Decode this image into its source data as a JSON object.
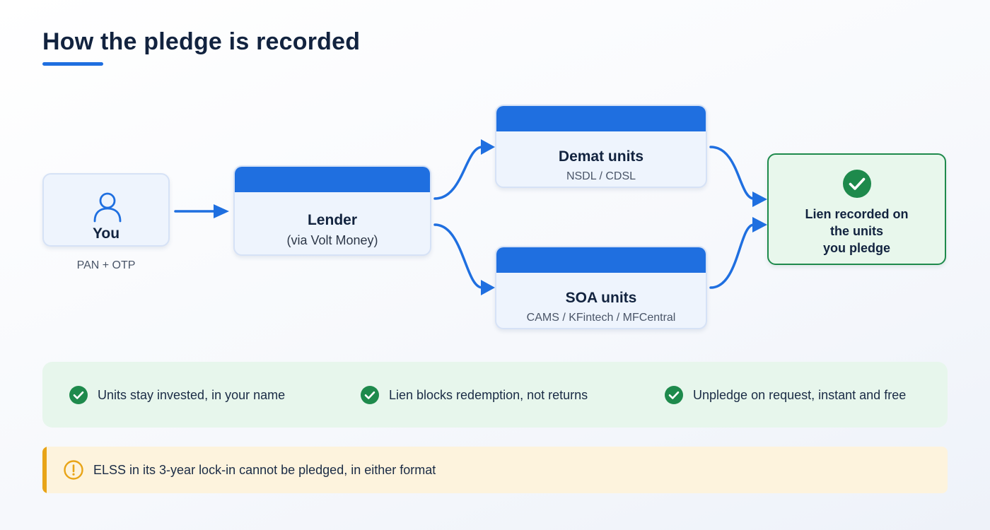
{
  "header": {
    "title": "How the pledge is recorded"
  },
  "diagram": {
    "you": {
      "icon": "user-icon",
      "label": "You",
      "caption": "PAN + OTP"
    },
    "lender": {
      "title": "Lender",
      "subtitle": "(via Volt Money)"
    },
    "demat": {
      "title": "Demat units",
      "subtitle": "NSDL / CDSL"
    },
    "soa": {
      "title": "SOA units",
      "subtitle": "CAMS / KFintech / MFCentral"
    },
    "lien": {
      "icon": "check-circle-icon",
      "line1": "Lien recorded on",
      "line2": "the units",
      "line3": "you pledge"
    }
  },
  "benefits": [
    {
      "icon": "check-circle-icon",
      "text": "Units stay invested, in your name"
    },
    {
      "icon": "check-circle-icon",
      "text": "Lien blocks redemption, not returns"
    },
    {
      "icon": "check-circle-icon",
      "text": "Unpledge on request, instant and free"
    }
  ],
  "warning": {
    "icon": "warning-circle-icon",
    "text": "ELSS in its 3-year lock-in cannot be pledged, in either format"
  },
  "colors": {
    "accent": "#1f6fe0",
    "success": "#1e8a4c",
    "warning": "#e8a417",
    "heading": "#12233f"
  }
}
